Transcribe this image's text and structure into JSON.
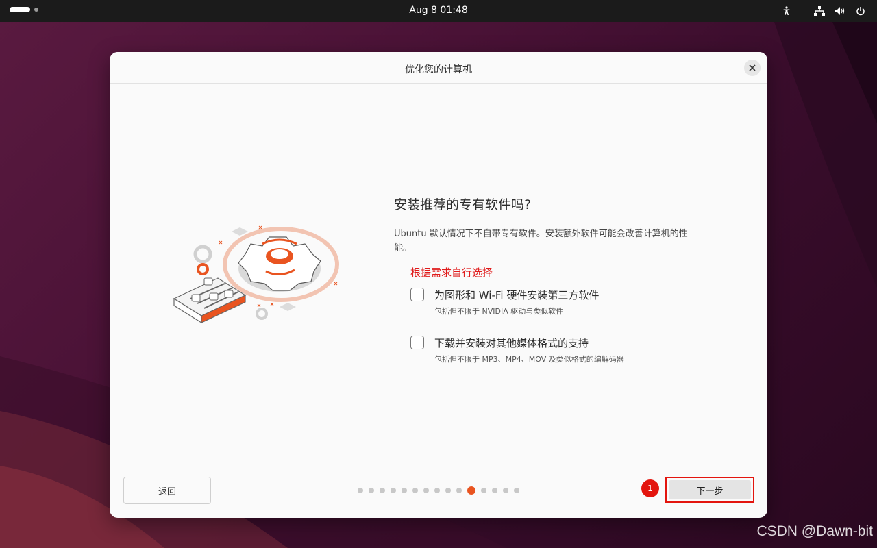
{
  "topbar": {
    "clock": "Aug 8  01:48",
    "icons": [
      "accessibility-icon",
      "network-icon",
      "volume-icon",
      "power-icon"
    ]
  },
  "dialog": {
    "title": "优化您的计算机",
    "question": "安装推荐的专有软件吗?",
    "description": "Ubuntu 默认情况下不自带专有软件。安装额外软件可能会改善计算机的性能。",
    "annotation": "根据需求自行选择",
    "options": [
      {
        "label": "为图形和 Wi-Fi 硬件安装第三方软件",
        "sub": "包括但不限于 NVIDIA 驱动与类似软件",
        "checked": false
      },
      {
        "label": "下载并安装对其他媒体格式的支持",
        "sub": "包括但不限于 MP3、MP4、MOV 及类似格式的编解码器",
        "checked": false
      }
    ],
    "back_label": "返回",
    "next_label": "下一步",
    "badge": "1",
    "progress": {
      "total": 15,
      "current": 11
    }
  },
  "watermark": "CSDN @Dawn-bit",
  "colors": {
    "accent": "#e95420",
    "highlight": "#e3150e"
  }
}
